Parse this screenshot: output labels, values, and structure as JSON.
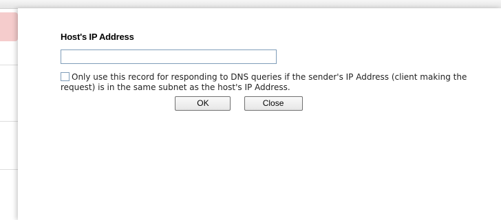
{
  "dialog": {
    "field_label": "Host's IP Address",
    "ip_input": {
      "value": "",
      "placeholder": ""
    },
    "option": {
      "checked": false,
      "text": "Only use this record for responding to DNS queries if the sender's IP Address (client making the request) is in the same subnet as the host's IP Address."
    },
    "buttons": {
      "ok_label": "OK",
      "close_label": "Close"
    }
  },
  "colors": {
    "input_border": "#7f9db9",
    "background_accent": "#f3c3c3"
  },
  "icons": {
    "checkbox": "checkbox-icon"
  }
}
